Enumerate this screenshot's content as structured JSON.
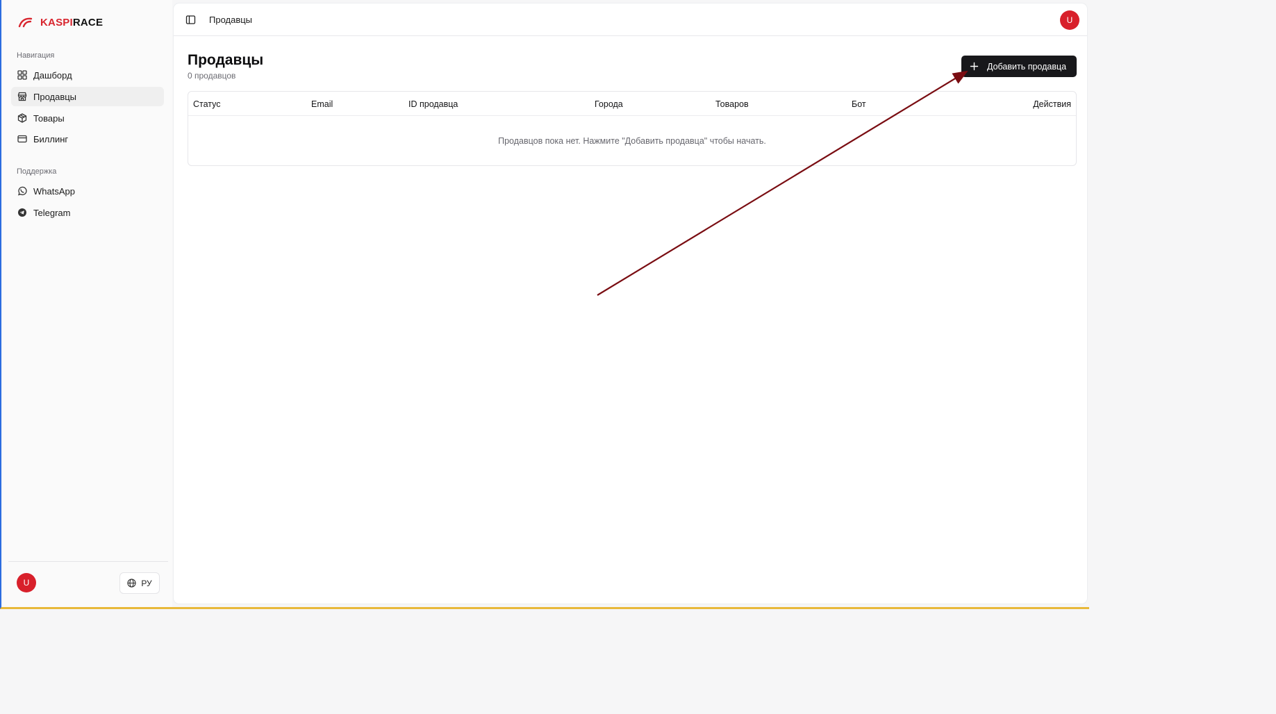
{
  "brand": {
    "part1": "KASPI",
    "part2": "RACE"
  },
  "sidebar": {
    "nav_label": "Навигация",
    "nav_items": [
      {
        "label": "Дашборд",
        "icon": "grid-icon"
      },
      {
        "label": "Продавцы",
        "icon": "store-icon",
        "active": true
      },
      {
        "label": "Товары",
        "icon": "box-icon"
      },
      {
        "label": "Биллинг",
        "icon": "card-icon"
      }
    ],
    "support_label": "Поддержка",
    "support_items": [
      {
        "label": "WhatsApp",
        "icon": "whatsapp-icon"
      },
      {
        "label": "Telegram",
        "icon": "telegram-icon"
      }
    ],
    "user_initial": "U",
    "language": "РУ"
  },
  "header": {
    "breadcrumb": "Продавцы",
    "user_initial": "U"
  },
  "main": {
    "title": "Продавцы",
    "subtitle": "0 продавцов",
    "add_button": "Добавить продавца",
    "table": {
      "columns": [
        "Статус",
        "Email",
        "ID продавца",
        "Города",
        "Товаров",
        "Бот",
        "Действия"
      ],
      "empty_text": "Продавцов пока нет. Нажмите \"Добавить продавца\" чтобы начать."
    }
  },
  "colors": {
    "accent_red": "#d8202b",
    "button_dark": "#18181b",
    "annotation_arrow": "#7a0d12"
  }
}
